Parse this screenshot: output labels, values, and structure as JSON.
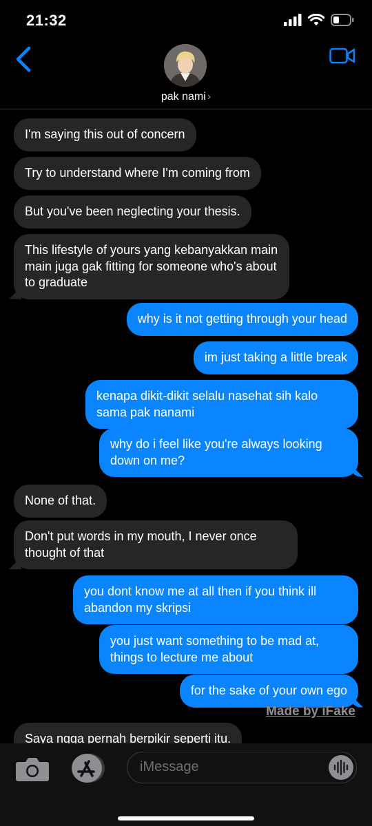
{
  "status_bar": {
    "time": "21:32"
  },
  "header": {
    "contact_name": "pak nami",
    "chevron": "›"
  },
  "messages": [
    {
      "from": "them",
      "text": "I'm saying this out of concern"
    },
    {
      "from": "them",
      "text": "Try to understand where I'm coming from"
    },
    {
      "from": "them",
      "text": "But you've been neglecting your thesis."
    },
    {
      "from": "them",
      "text": "This lifestyle of yours yang kebanyakkan main main juga gak fitting for someone who's about to graduate"
    },
    {
      "from": "me",
      "text": "why is it not getting through your head"
    },
    {
      "from": "me",
      "text": "im just taking a little break"
    },
    {
      "from": "me",
      "text": "kenapa dikit-dikit selalu nasehat sih kalo sama pak nanami"
    },
    {
      "from": "me",
      "text": "why do i feel like you're always looking down on me?"
    },
    {
      "from": "them",
      "text": "None of that."
    },
    {
      "from": "them",
      "text": "Don't put words in my mouth, I never once thought of that"
    },
    {
      "from": "me",
      "text": "you dont know me at all then if you think ill abandon my skripsi"
    },
    {
      "from": "me",
      "text": "you just want something to be mad at, things to lecture me about"
    },
    {
      "from": "me",
      "text": "for the sake of your own ego"
    },
    {
      "from": "them",
      "text": "Saya ngga pernah berpikir seperti itu."
    }
  ],
  "watermark": "Made by iFake",
  "compose": {
    "placeholder": "iMessage"
  },
  "colors": {
    "sent_bubble": "#0a84ff",
    "received_bubble": "#262628",
    "accent": "#0a84ff"
  },
  "icons": [
    "signal-icon",
    "wifi-icon",
    "battery-icon",
    "back-chevron-icon",
    "video-call-icon",
    "camera-icon",
    "app-store-icon",
    "audio-message-icon"
  ]
}
